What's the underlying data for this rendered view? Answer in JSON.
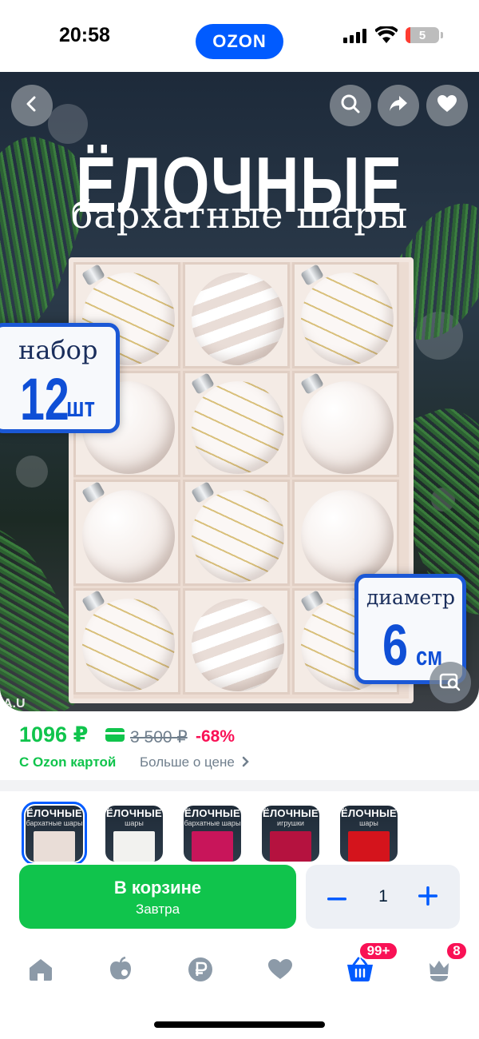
{
  "status_bar": {
    "time": "20:58",
    "logo": "OZON",
    "battery_level": "5",
    "icons": [
      "signal-icon",
      "wifi-icon",
      "battery-icon"
    ]
  },
  "hero": {
    "title": "ЁЛОЧНЫЕ",
    "subtitle": "бархатные шары",
    "set_badge": {
      "label": "набор",
      "number": "12",
      "unit": "шт"
    },
    "diameter_badge": {
      "label": "диаметр",
      "number": "6",
      "unit": "см"
    },
    "brand_watermark": "A.U",
    "buttons": [
      "back-icon",
      "search-icon",
      "share-icon",
      "favorite-icon",
      "image-search-icon"
    ]
  },
  "price_block": {
    "price": "1096 ₽",
    "old_price": "3 500 ₽",
    "discount": "-68%",
    "ozon_card_label": "С Ozon картой",
    "more_about_price": "Больше о цене",
    "price_color": "#10c44c",
    "discount_color": "#f91155"
  },
  "thumbnails": [
    {
      "title": "ЁЛОЧНЫЕ",
      "subtitle": "бархатные шары",
      "color": "#e9ddd7",
      "selected": true
    },
    {
      "title": "ЁЛОЧНЫЕ",
      "subtitle": "шары",
      "color": "#f2f2ef",
      "selected": false
    },
    {
      "title": "ЁЛОЧНЫЕ",
      "subtitle": "бархатные шары",
      "color": "#c8155a",
      "selected": false
    },
    {
      "title": "ЁЛОЧНЫЕ",
      "subtitle": "игрушки",
      "color": "#b5123f",
      "selected": false
    },
    {
      "title": "ЁЛОЧНЫЕ",
      "subtitle": "шары",
      "color": "#d4141c",
      "selected": false
    }
  ],
  "action_bar": {
    "cart_label": "В корзине",
    "delivery": "Завтра",
    "quantity": "1",
    "accent_color": "#005bff"
  },
  "tabbar": {
    "tabs": [
      "home-icon",
      "fresh-icon",
      "finance-icon",
      "favorites-icon",
      "cart-icon",
      "profile-icon"
    ],
    "cart_badge": "99+",
    "profile_badge": "8",
    "active": "cart-icon"
  }
}
